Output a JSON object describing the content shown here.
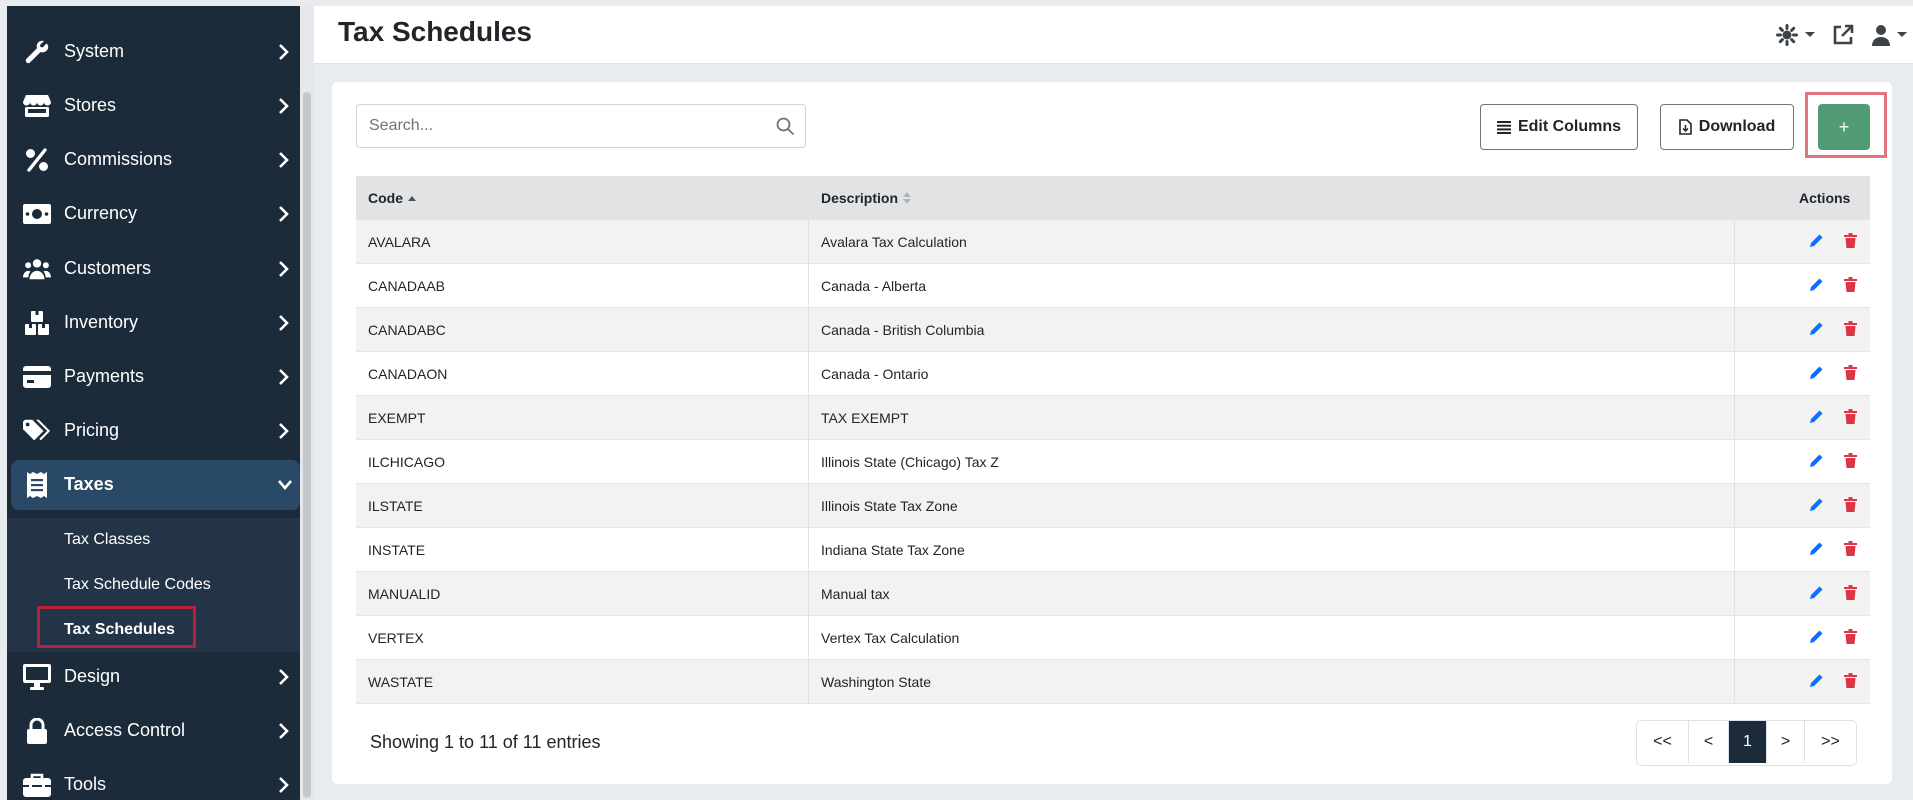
{
  "sidebar": {
    "items": [
      {
        "label": "System",
        "icon": "wrench-icon"
      },
      {
        "label": "Stores",
        "icon": "store-icon"
      },
      {
        "label": "Commissions",
        "icon": "percent-icon"
      },
      {
        "label": "Currency",
        "icon": "money-bill-icon"
      },
      {
        "label": "Customers",
        "icon": "users-icon"
      },
      {
        "label": "Inventory",
        "icon": "boxes-icon"
      },
      {
        "label": "Payments",
        "icon": "credit-card-icon"
      },
      {
        "label": "Pricing",
        "icon": "tags-icon"
      },
      {
        "label": "Taxes",
        "icon": "receipt-icon"
      },
      {
        "label": "Design",
        "icon": "desktop-icon"
      },
      {
        "label": "Access Control",
        "icon": "lock-icon"
      },
      {
        "label": "Tools",
        "icon": "toolbox-icon"
      }
    ],
    "taxes_submenu": [
      "Tax Classes",
      "Tax Schedule Codes",
      "Tax Schedules"
    ]
  },
  "header": {
    "title": "Tax Schedules"
  },
  "toolbar": {
    "search_placeholder": "Search...",
    "edit_columns_label": "Edit Columns",
    "download_label": "Download",
    "add_label": "+"
  },
  "table": {
    "columns": [
      "Code",
      "Description",
      "Actions"
    ],
    "rows": [
      {
        "code": "AVALARA",
        "description": "Avalara Tax Calculation"
      },
      {
        "code": "CANADAAB",
        "description": "Canada - Alberta"
      },
      {
        "code": "CANADABC",
        "description": "Canada - British Columbia"
      },
      {
        "code": "CANADAON",
        "description": "Canada - Ontario"
      },
      {
        "code": "EXEMPT",
        "description": "TAX EXEMPT"
      },
      {
        "code": "ILCHICAGO",
        "description": "Illinois State (Chicago) Tax Z"
      },
      {
        "code": "ILSTATE",
        "description": "Illinois State Tax Zone"
      },
      {
        "code": "INSTATE",
        "description": "Indiana State Tax Zone"
      },
      {
        "code": "MANUALID",
        "description": "Manual tax"
      },
      {
        "code": "VERTEX",
        "description": "Vertex Tax Calculation"
      },
      {
        "code": "WASTATE",
        "description": "Washington State"
      }
    ]
  },
  "footer": {
    "showing": "Showing 1 to 11 of 11 entries",
    "pager": [
      "<<",
      "<",
      "1",
      ">",
      ">>"
    ]
  },
  "colors": {
    "sidebar_bg": "#1c2b3a",
    "active_item_bg": "#2a4966",
    "add_button": "#519b75",
    "edit_icon": "#0d6efd",
    "delete_icon": "#dc3545",
    "highlight_red": "#b8213a"
  }
}
